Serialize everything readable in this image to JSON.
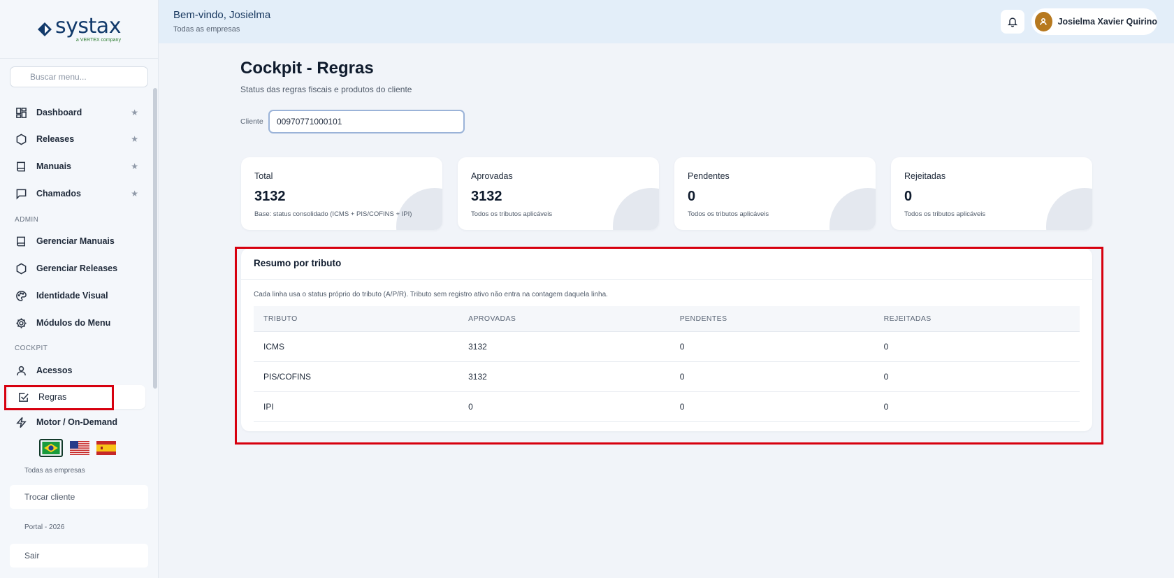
{
  "sidebar": {
    "logo": {
      "word": "systax",
      "sub": "a VERTEX company"
    },
    "search_placeholder": "Buscar menu...",
    "main_items": [
      {
        "label": "Dashboard",
        "icon": "dashboard-icon",
        "starred": true
      },
      {
        "label": "Releases",
        "icon": "hexagon-icon",
        "starred": true
      },
      {
        "label": "Manuais",
        "icon": "book-icon",
        "starred": true
      },
      {
        "label": "Chamados",
        "icon": "chat-icon",
        "starred": true
      }
    ],
    "admin_label": "ADMIN",
    "admin_items": [
      {
        "label": "Gerenciar Manuais",
        "icon": "book-icon"
      },
      {
        "label": "Gerenciar Releases",
        "icon": "hexagon-icon"
      },
      {
        "label": "Identidade Visual",
        "icon": "palette-icon"
      },
      {
        "label": "Módulos do Menu",
        "icon": "gear-icon"
      }
    ],
    "cockpit_label": "COCKPIT",
    "cockpit_items": [
      {
        "label": "Acessos",
        "icon": "user-icon"
      },
      {
        "label": "Regras",
        "icon": "checkbox-icon",
        "active": true
      },
      {
        "label": "Motor / On-Demand",
        "icon": "bolt-icon"
      }
    ],
    "star_glyph": "★",
    "languages": [
      "pt-BR",
      "en-US",
      "es-ES"
    ],
    "company_scope": "Todas as empresas",
    "switch_client_label": "Trocar cliente",
    "footer": "Portal - 2026",
    "logout_label": "Sair"
  },
  "header": {
    "welcome": "Bem-vindo, Josielma",
    "scope": "Todas as empresas",
    "user_name": "Josielma Xavier Quirino"
  },
  "main": {
    "title": "Cockpit - Regras",
    "subtitle": "Status das regras fiscais e produtos do cliente",
    "client_label": "Cliente",
    "client_value": "00970771000101",
    "cards": [
      {
        "label": "Total",
        "value": "3132",
        "note": "Base: status consolidado (ICMS + PIS/COFINS + IPI)"
      },
      {
        "label": "Aprovadas",
        "value": "3132",
        "note": "Todos os tributos aplicáveis"
      },
      {
        "label": "Pendentes",
        "value": "0",
        "note": "Todos os tributos aplicáveis"
      },
      {
        "label": "Rejeitadas",
        "value": "0",
        "note": "Todos os tributos aplicáveis"
      }
    ],
    "summary": {
      "title": "Resumo por tributo",
      "note": "Cada linha usa o status próprio do tributo (A/P/R). Tributo sem registro ativo não entra na contagem daquela linha.",
      "columns": [
        "TRIBUTO",
        "APROVADAS",
        "PENDENTES",
        "REJEITADAS"
      ],
      "rows": [
        [
          "ICMS",
          "3132",
          "0",
          "0"
        ],
        [
          "PIS/COFINS",
          "3132",
          "0",
          "0"
        ],
        [
          "IPI",
          "0",
          "0",
          "0"
        ]
      ]
    }
  },
  "colors": {
    "highlight": "#d7000f",
    "brand": "#123a6b",
    "accent_green": "#2e7d32"
  }
}
